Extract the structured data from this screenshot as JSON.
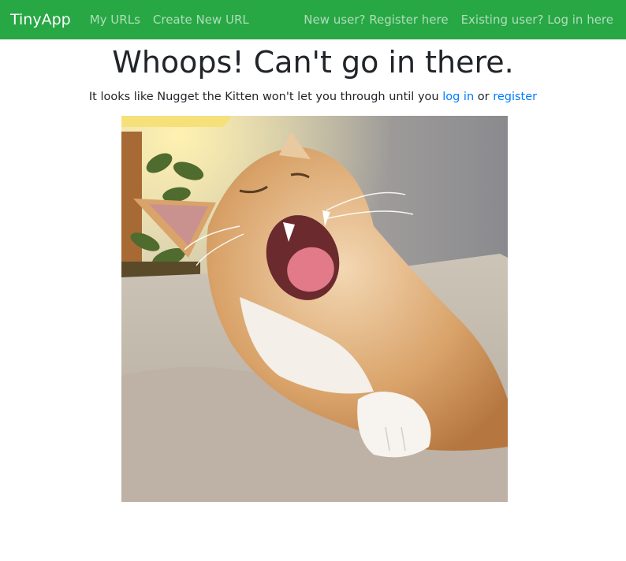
{
  "navbar": {
    "brand": "TinyApp",
    "links_left": [
      "My URLs",
      "Create New URL"
    ],
    "links_right": [
      "New user? Register here",
      "Existing user? Log in here"
    ],
    "bg_color": "#28a745"
  },
  "main": {
    "title": "Whoops! Can't go in there.",
    "message_prefix": "It looks like Nugget the Kitten won't let you through until you",
    "login_link": "log in",
    "conjunction": "or",
    "register_link": "register",
    "link_color": "#007bff",
    "image_subject": "yawning-orange-white-kitten-photo"
  }
}
